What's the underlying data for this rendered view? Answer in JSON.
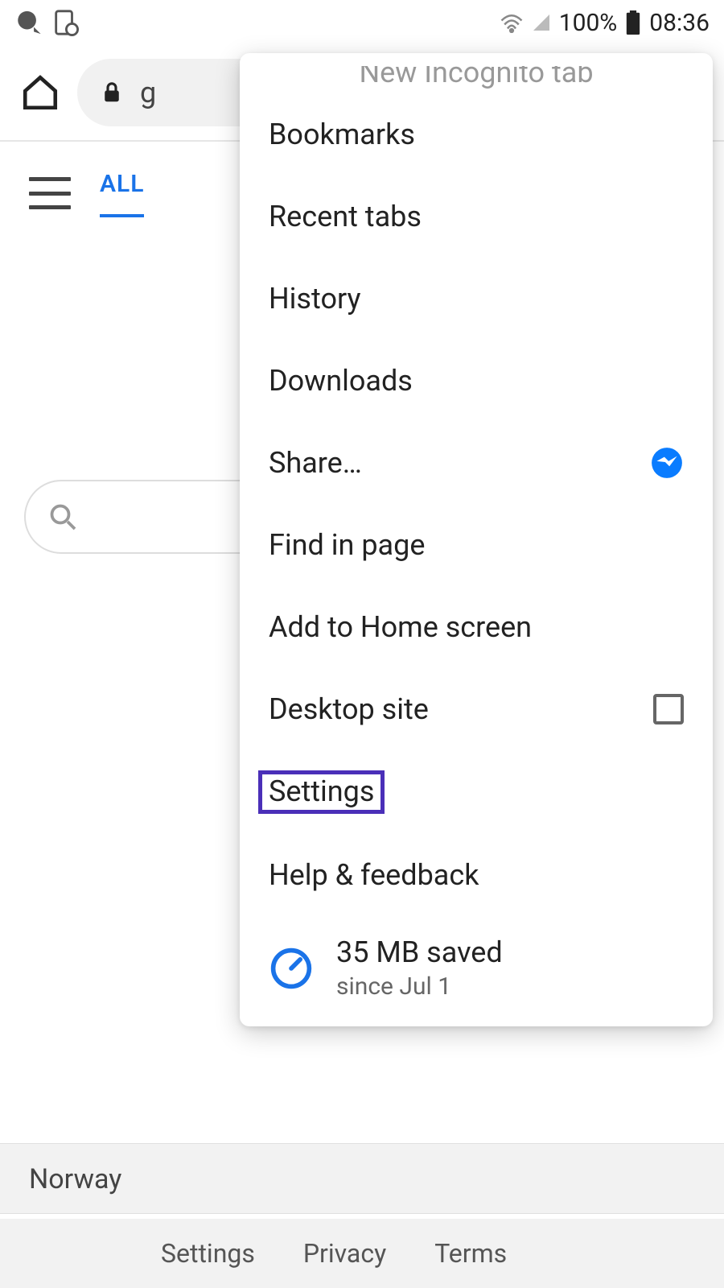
{
  "status_bar": {
    "battery_pct": "100%",
    "time": "08:36"
  },
  "toolbar": {
    "url_fragment": "g"
  },
  "tabs": {
    "active": "ALL"
  },
  "menu": {
    "truncated_top": "New Incognito tab",
    "items": [
      {
        "label": "Bookmarks"
      },
      {
        "label": "Recent tabs"
      },
      {
        "label": "History"
      },
      {
        "label": "Downloads"
      },
      {
        "label": "Share…"
      },
      {
        "label": "Find in page"
      },
      {
        "label": "Add to Home screen"
      },
      {
        "label": "Desktop site"
      },
      {
        "label": "Settings"
      },
      {
        "label": "Help & feedback"
      }
    ],
    "data_saver": {
      "primary": "35 MB saved",
      "secondary": "since Jul 1"
    }
  },
  "location": {
    "country": "Norway"
  },
  "footer": {
    "settings": "Settings",
    "privacy": "Privacy",
    "terms": "Terms"
  }
}
